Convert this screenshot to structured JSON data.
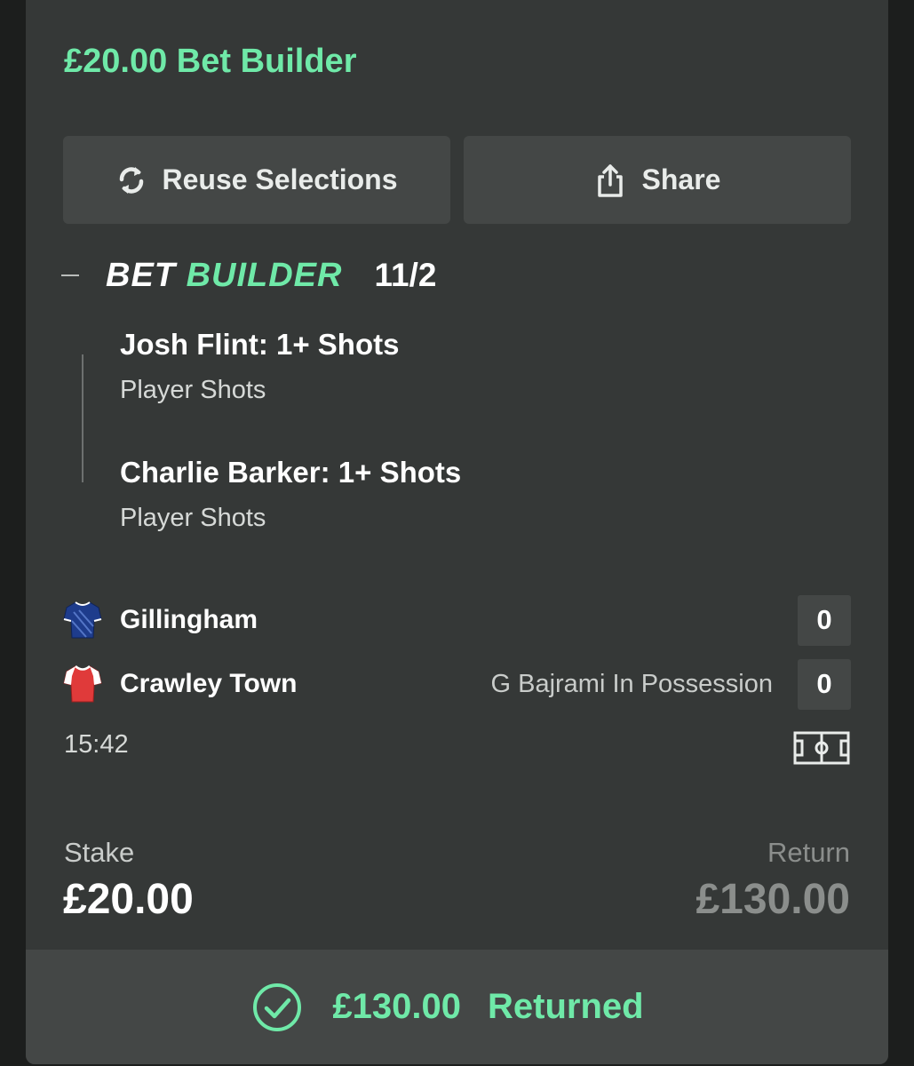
{
  "bet": {
    "title": "£20.00 Bet Builder",
    "reuse_label": "Reuse Selections",
    "share_label": "Share",
    "builder_word1": "BET",
    "builder_word2": "BUILDER",
    "odds": "11/2"
  },
  "legs": [
    {
      "title": "Josh Flint: 1+ Shots",
      "market": "Player Shots"
    },
    {
      "title": "Charlie Barker: 1+ Shots",
      "market": "Player Shots"
    }
  ],
  "match": {
    "home": {
      "name": "Gillingham",
      "score": "0",
      "shirt_color": "#1e3c8c"
    },
    "away": {
      "name": "Crawley Town",
      "score": "0",
      "shirt_color": "#e03a3a",
      "status": "G Bajrami In Possession"
    },
    "time": "15:42"
  },
  "stake": {
    "label": "Stake",
    "value": "£20.00"
  },
  "return": {
    "label": "Return",
    "value": "£130.00"
  },
  "result": {
    "amount": "£130.00",
    "status": "Returned"
  },
  "colors": {
    "accent": "#6fe9a8",
    "card": "#353837",
    "button": "#444746"
  },
  "icons": [
    "refresh-icon",
    "share-icon",
    "gillingham-shirt-icon",
    "crawley-shirt-icon",
    "pitch-icon",
    "check-circle-icon"
  ]
}
